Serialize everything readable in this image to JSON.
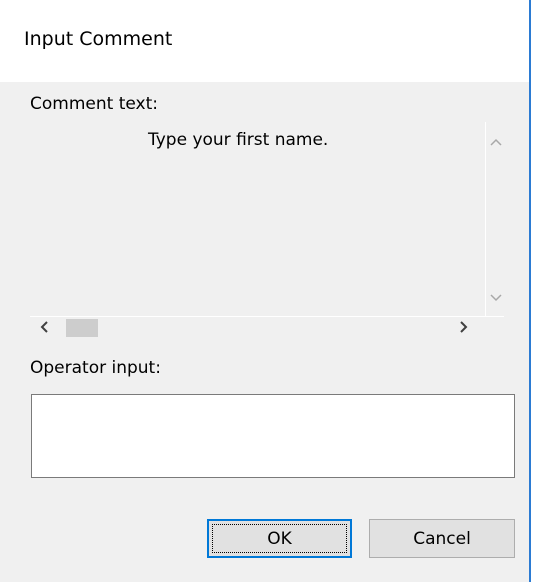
{
  "window": {
    "title": "Input Comment"
  },
  "comment": {
    "label": "Comment text:",
    "text": "Type your first name.",
    "scroll_up_icon": "chevron-up",
    "scroll_down_icon": "chevron-down",
    "scroll_left_icon": "chevron-left",
    "scroll_right_icon": "chevron-right"
  },
  "operator": {
    "label": "Operator input:",
    "value": "",
    "placeholder": ""
  },
  "buttons": {
    "ok_label": "OK",
    "cancel_label": "Cancel"
  },
  "colors": {
    "accent": "#0078d7",
    "window_border": "#2b7bd3",
    "dialog_background": "#f0f0f0"
  }
}
